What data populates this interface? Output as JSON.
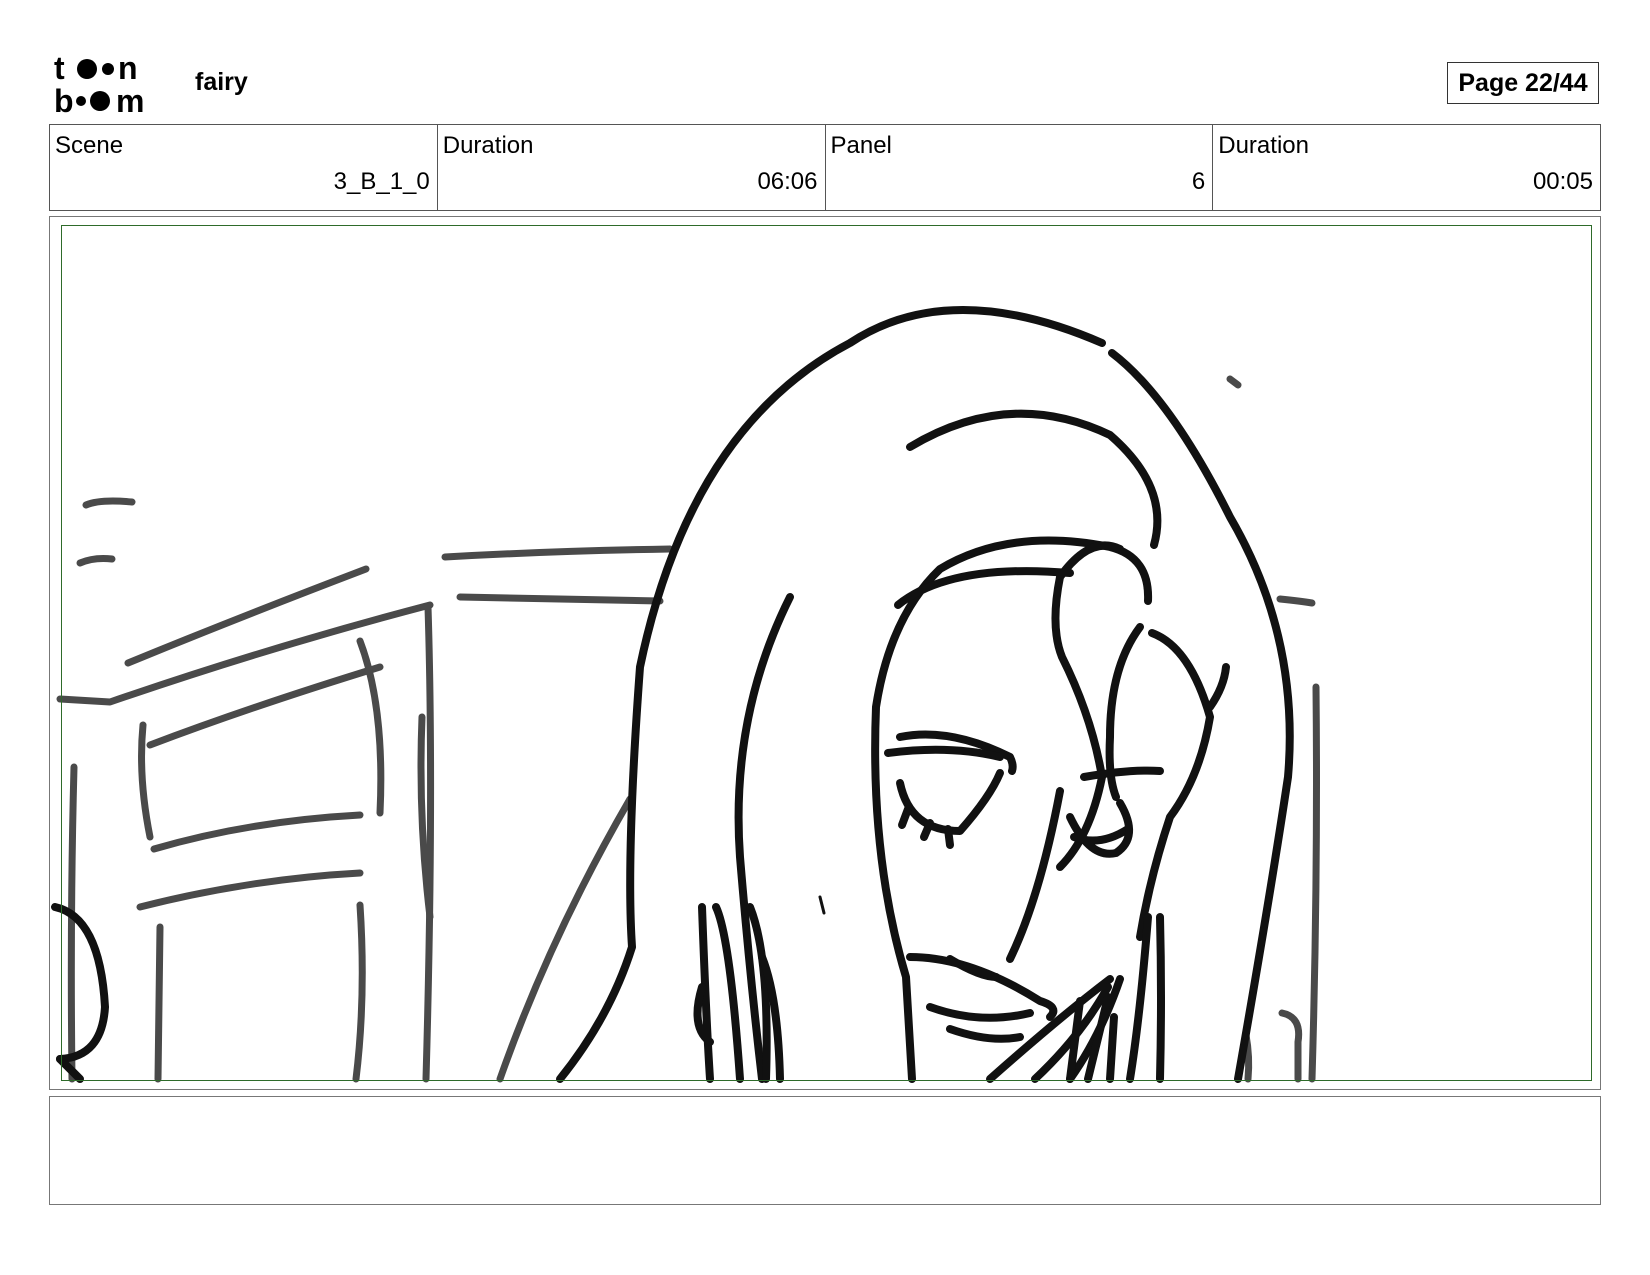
{
  "header": {
    "logo_text": "toon boom",
    "project_name": "fairy",
    "page_label": "Page 22/44"
  },
  "info_bar": [
    {
      "label": "Scene",
      "value": "3_B_1_0"
    },
    {
      "label": "Duration",
      "value": "06:06"
    },
    {
      "label": "Panel",
      "value": "6"
    },
    {
      "label": "Duration",
      "value": "00:05"
    }
  ],
  "panel": {
    "image_icon": "storyboard-sketch-girl-eyes-closed",
    "safe_frame_color": "#2e6b2a"
  },
  "notes": {
    "text": ""
  }
}
